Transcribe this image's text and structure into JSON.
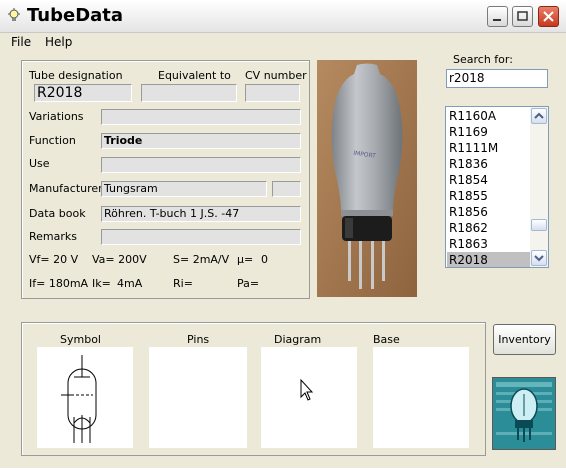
{
  "window": {
    "title": "TubeData"
  },
  "menu": [
    "File",
    "Help"
  ],
  "info": {
    "tube_designation_label": "Tube designation",
    "equivalent_label": "Equivalent to",
    "cv_label": "CV number",
    "tube_designation": "R2018",
    "equivalent": "",
    "cv_number": "",
    "variations_label": "Variations",
    "variations": "",
    "function_label": "Function",
    "function": "Triode",
    "use_label": "Use",
    "use": "",
    "manufacturer_label": "Manufacturer",
    "manufacturer": "Tungsram",
    "manufacturer_code": "",
    "databook_label": "Data book",
    "databook": "Röhren. T-buch 1 J.S. -47",
    "remarks_label": "Remarks",
    "remarks": "",
    "params_row1": [
      "Vf= 20 V",
      "Va= 200V",
      "S= 2mA/V",
      "µ=",
      "0"
    ],
    "params_row2": [
      "If= 180mA",
      "Ik=",
      "4mA",
      "Ri=",
      "Pa="
    ]
  },
  "search": {
    "label": "Search for:",
    "value": "r2018"
  },
  "list": {
    "items": [
      "R1160A",
      "R1169",
      "R1111M",
      "R1836",
      "R1854",
      "R1855",
      "R1856",
      "R1862",
      "R1863",
      "R2018"
    ],
    "selected": "R2018"
  },
  "bottom_labels": [
    "Symbol",
    "Pins",
    "Diagram",
    "Base"
  ],
  "inventory_button": "Inventory",
  "tube_photo_text": "IMPORT"
}
